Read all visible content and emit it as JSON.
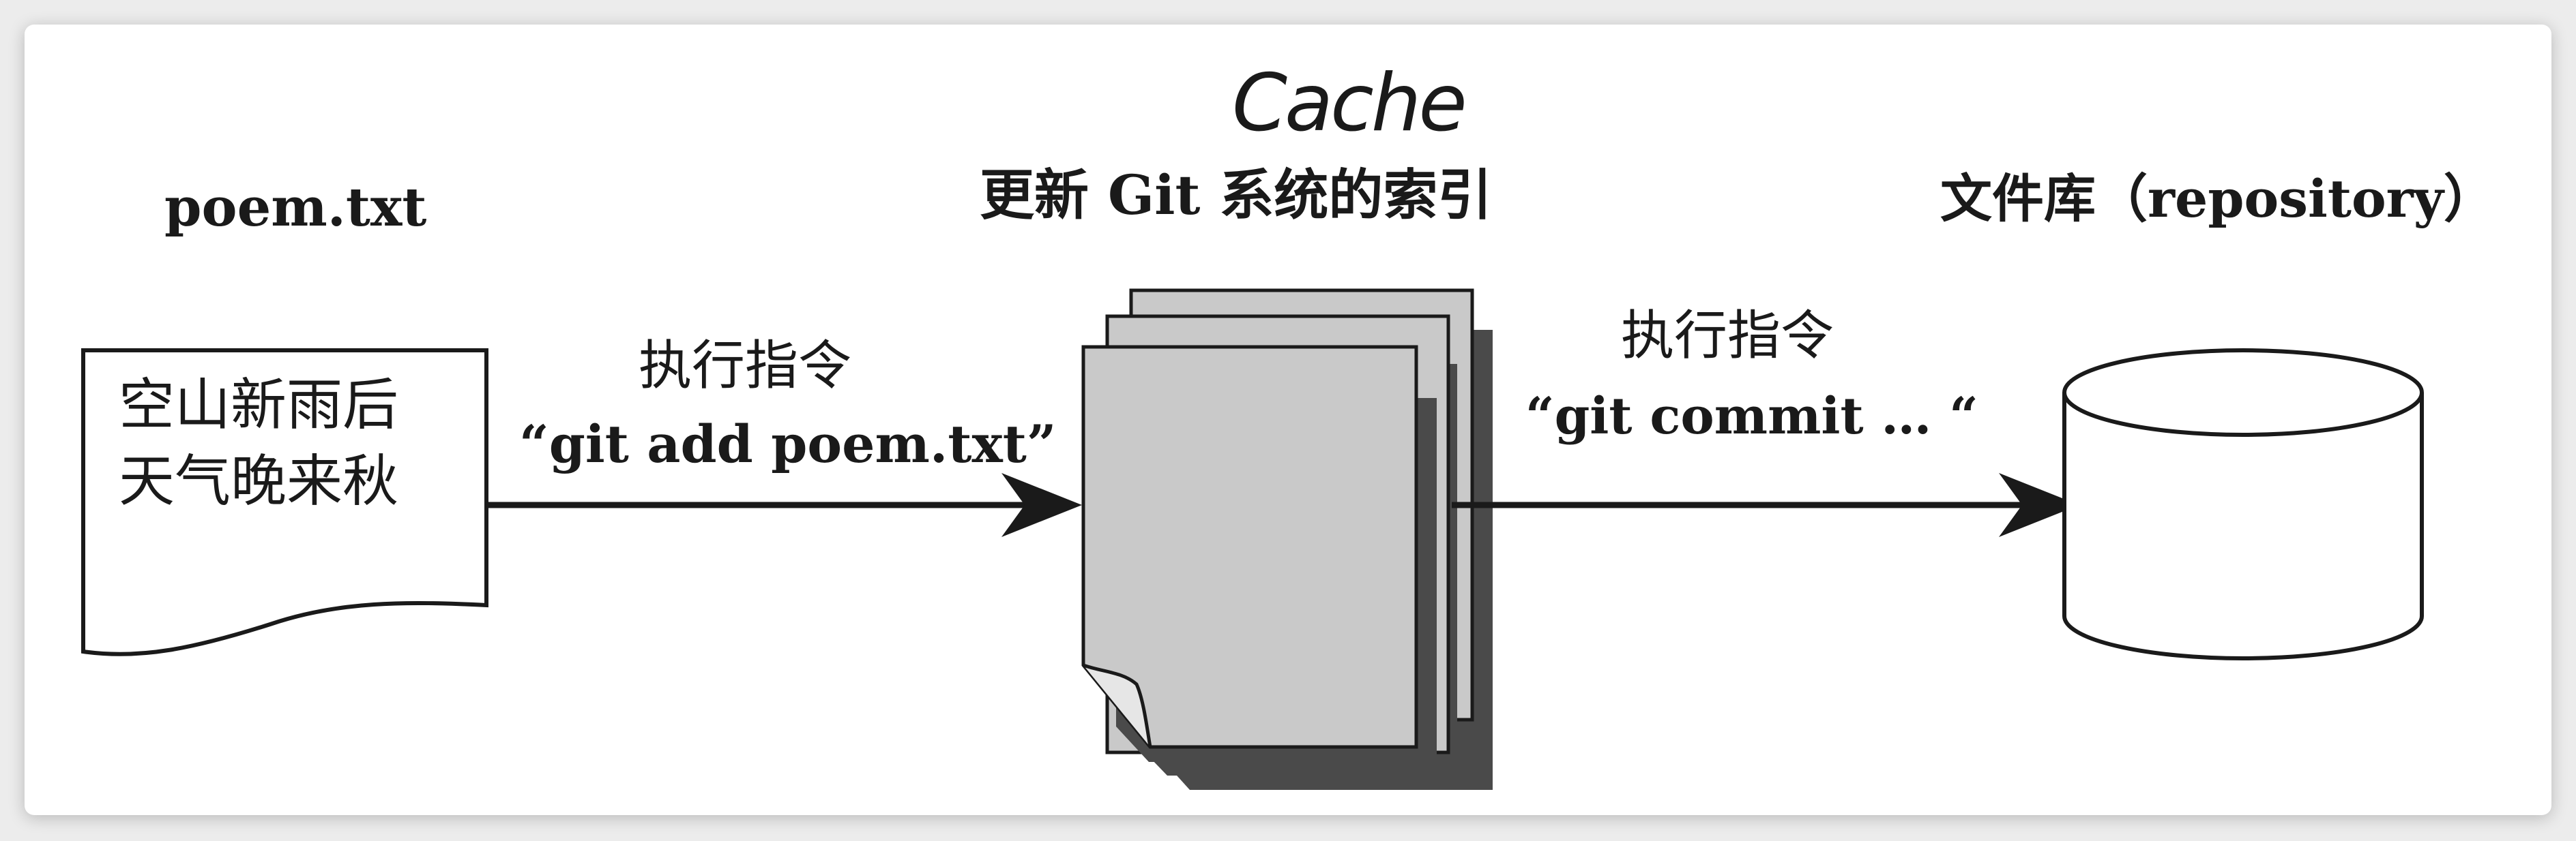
{
  "file": {
    "name": "poem.txt",
    "lines": [
      "空山新雨后",
      "天气晚来秋"
    ]
  },
  "add_step": {
    "label": "执行指令",
    "command": "“git add poem.txt”"
  },
  "index": {
    "handwritten_note": "Cache",
    "label": "更新 Git 系统的索引"
  },
  "commit_step": {
    "label": "执行指令",
    "command": "“git commit … “"
  },
  "repository": {
    "label": "文件库（repository）"
  },
  "colors": {
    "ink": "#1a1a1a",
    "page_fill": "#c9c9c9",
    "shadow_fill": "#4a4a4a",
    "background": "#ffffff"
  }
}
